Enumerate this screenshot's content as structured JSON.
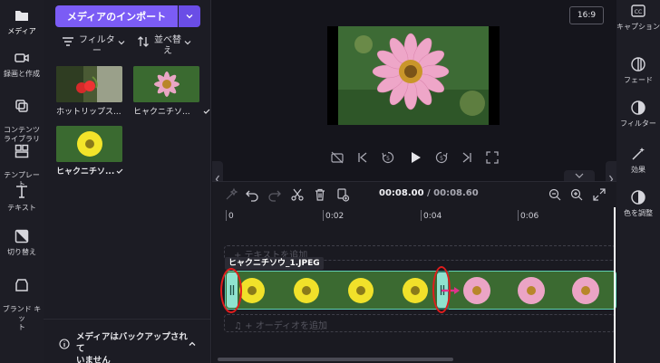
{
  "left_rail": {
    "items": [
      {
        "label": "メディア",
        "icon": "folder-icon"
      },
      {
        "label": "録画と作成",
        "icon": "camera-icon"
      },
      {
        "label": "コンテンツ\nライブラリ",
        "icon": "library-icon"
      },
      {
        "label": "テンプレー\nト",
        "icon": "template-icon"
      },
      {
        "label": "テキスト",
        "icon": "text-icon"
      },
      {
        "label": "切り替え",
        "icon": "transition-icon"
      },
      {
        "label": "ブランド キッ\nト",
        "icon": "brand-kit-icon"
      }
    ]
  },
  "media_panel": {
    "import_label": "メディアのインポート",
    "filter_label": "フィルタ\nー",
    "sort_label": "並べ替\nえ",
    "items": [
      {
        "label": "ホットリップス..."
      },
      {
        "label": "ヒャクニチソ..."
      },
      {
        "label": "ヒャクニチソ..."
      }
    ],
    "backup_text": "メディアはバックアップされて\nいません"
  },
  "preview": {
    "aspect_ratio": "16:9"
  },
  "right_rail": {
    "items": [
      {
        "label": "キャプション",
        "icon": "captions-icon"
      },
      {
        "label": "フェード",
        "icon": "fade-icon"
      },
      {
        "label": "フィルター",
        "icon": "filter-icon"
      },
      {
        "label": "効果",
        "icon": "effects-icon"
      },
      {
        "label": "色を調整",
        "icon": "color-adjust-icon"
      }
    ]
  },
  "timeline": {
    "current_time": "00:08.00",
    "separator": " / ",
    "total_time": "00:08.60",
    "ruler": [
      "0",
      "0:02",
      "0:04",
      "0:06"
    ],
    "text_track_placeholder": "+ テキストを追加",
    "audio_track_placeholder": "♫ + オーディオを追加",
    "clip_label": "ヒャクニチソウ_1.JPEG"
  },
  "colors": {
    "accent": "#7b5cf5",
    "clip": "#2f7a6a",
    "handle": "#8fe3cf",
    "highlight": "#e01d1d"
  }
}
